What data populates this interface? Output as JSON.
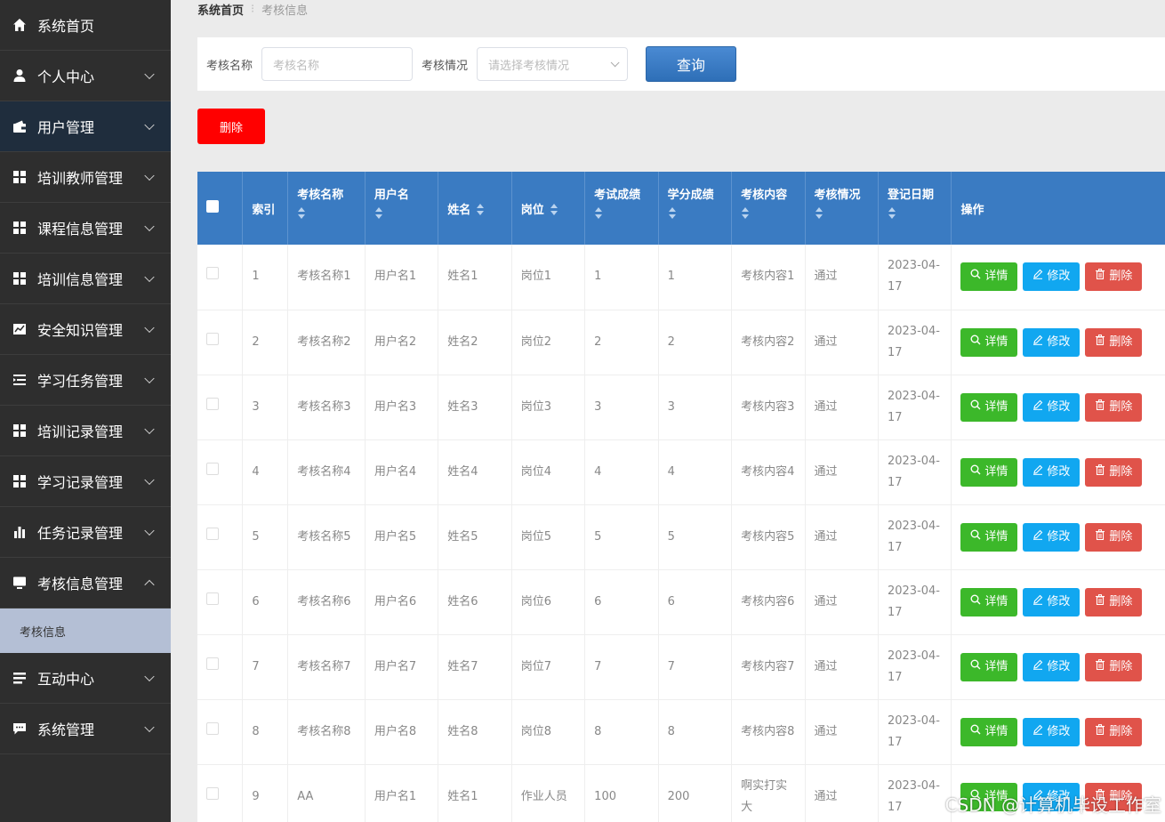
{
  "sidebar": {
    "items": [
      {
        "label": "系统首页",
        "icon": "home-icon",
        "chevron": "none"
      },
      {
        "label": "个人中心",
        "icon": "user-icon",
        "chevron": "down"
      },
      {
        "label": "用户管理",
        "icon": "wallet-icon",
        "chevron": "down",
        "active": true
      },
      {
        "label": "培训教师管理",
        "icon": "grid-icon",
        "chevron": "down"
      },
      {
        "label": "课程信息管理",
        "icon": "grid-icon",
        "chevron": "down"
      },
      {
        "label": "培训信息管理",
        "icon": "grid-icon",
        "chevron": "down"
      },
      {
        "label": "安全知识管理",
        "icon": "chart-line-icon",
        "chevron": "down"
      },
      {
        "label": "学习任务管理",
        "icon": "list-indent-icon",
        "chevron": "down"
      },
      {
        "label": "培训记录管理",
        "icon": "grid-icon",
        "chevron": "down"
      },
      {
        "label": "学习记录管理",
        "icon": "grid-icon",
        "chevron": "down"
      },
      {
        "label": "任务记录管理",
        "icon": "bar-chart-icon",
        "chevron": "down"
      },
      {
        "label": "考核信息管理",
        "icon": "monitor-icon",
        "chevron": "up"
      }
    ],
    "sub_item": "考核信息",
    "items_after": [
      {
        "label": "互动中心",
        "icon": "list-icon",
        "chevron": "down"
      },
      {
        "label": "系统管理",
        "icon": "chat-icon",
        "chevron": "down"
      }
    ]
  },
  "breadcrumb": {
    "home": "系统首页",
    "separator": "⁝",
    "current": "考核信息"
  },
  "search": {
    "name_label": "考核名称",
    "name_placeholder": "考核名称",
    "status_label": "考核情况",
    "status_placeholder": "请选择考核情况",
    "query_label": "查询"
  },
  "delete_label": "删除",
  "table": {
    "columns": [
      "索引",
      "考核名称",
      "用户名",
      "姓名",
      "岗位",
      "考试成绩",
      "学分成绩",
      "考核内容",
      "考核情况",
      "登记日期",
      "操作"
    ],
    "rows": [
      {
        "index": "1",
        "name": "考核名称1",
        "username": "用户名1",
        "realname": "姓名1",
        "post": "岗位1",
        "exam": "1",
        "credit": "1",
        "content": "考核内容1",
        "status": "通过",
        "date": "2023-04-17"
      },
      {
        "index": "2",
        "name": "考核名称2",
        "username": "用户名2",
        "realname": "姓名2",
        "post": "岗位2",
        "exam": "2",
        "credit": "2",
        "content": "考核内容2",
        "status": "通过",
        "date": "2023-04-17"
      },
      {
        "index": "3",
        "name": "考核名称3",
        "username": "用户名3",
        "realname": "姓名3",
        "post": "岗位3",
        "exam": "3",
        "credit": "3",
        "content": "考核内容3",
        "status": "通过",
        "date": "2023-04-17"
      },
      {
        "index": "4",
        "name": "考核名称4",
        "username": "用户名4",
        "realname": "姓名4",
        "post": "岗位4",
        "exam": "4",
        "credit": "4",
        "content": "考核内容4",
        "status": "通过",
        "date": "2023-04-17"
      },
      {
        "index": "5",
        "name": "考核名称5",
        "username": "用户名5",
        "realname": "姓名5",
        "post": "岗位5",
        "exam": "5",
        "credit": "5",
        "content": "考核内容5",
        "status": "通过",
        "date": "2023-04-17"
      },
      {
        "index": "6",
        "name": "考核名称6",
        "username": "用户名6",
        "realname": "姓名6",
        "post": "岗位6",
        "exam": "6",
        "credit": "6",
        "content": "考核内容6",
        "status": "通过",
        "date": "2023-04-17"
      },
      {
        "index": "7",
        "name": "考核名称7",
        "username": "用户名7",
        "realname": "姓名7",
        "post": "岗位7",
        "exam": "7",
        "credit": "7",
        "content": "考核内容7",
        "status": "通过",
        "date": "2023-04-17"
      },
      {
        "index": "8",
        "name": "考核名称8",
        "username": "用户名8",
        "realname": "姓名8",
        "post": "岗位8",
        "exam": "8",
        "credit": "8",
        "content": "考核内容8",
        "status": "通过",
        "date": "2023-04-17"
      },
      {
        "index": "9",
        "name": "AA",
        "username": "用户名1",
        "realname": "姓名1",
        "post": "作业人员",
        "exam": "100",
        "credit": "200",
        "content": "啊实打实大",
        "status": "通过",
        "date": "2023-04-17"
      }
    ],
    "actions": {
      "detail": "详情",
      "edit": "修改",
      "remove": "删除"
    }
  },
  "watermark": "CSDN @计算机毕设工作室",
  "colors": {
    "sidebar": "#2e2e2e",
    "header": "#3a7bc2",
    "detail": "#3cb82a",
    "edit": "#11a7f0",
    "remove": "#e0534a",
    "danger": "#ff0000"
  }
}
